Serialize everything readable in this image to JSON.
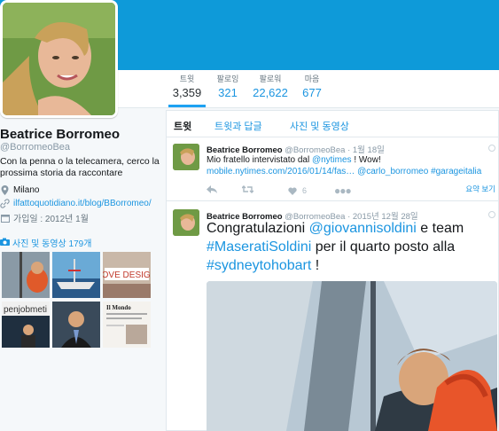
{
  "colors": {
    "banner": "#0e9ad9",
    "link": "#1b95e0",
    "accent": "#1da1f2"
  },
  "stats": [
    {
      "label": "트윗",
      "value": "3,359"
    },
    {
      "label": "팔로잉",
      "value": "321"
    },
    {
      "label": "팔로워",
      "value": "22,622"
    },
    {
      "label": "마음",
      "value": "677"
    }
  ],
  "profile": {
    "name": "Beatrice Borromeo",
    "handle": "@BorromeoBea",
    "bio": "Con la penna o la telecamera, cerco la prossima storia da raccontare",
    "location": "Milano",
    "website": "ilfattoquotidiano.it/blog/BBorromeo/",
    "joined": "가입일 : 2012년 1월",
    "photos_label": "사진 및 동영상 179개",
    "location_icon": "map-pin-icon",
    "link_icon": "link-icon",
    "calendar_icon": "calendar-icon",
    "camera_icon": "camera-icon"
  },
  "thumbs": [
    "",
    "",
    "LOVE DESIGN",
    "penjobmeti",
    "",
    "Il Mondo"
  ],
  "tabs": [
    "트윗",
    "트윗과 답글",
    "사진 및 동영상"
  ],
  "tweets": [
    {
      "name": "Beatrice Borromeo",
      "handle": "@BorromeoBea",
      "date": "· 1월 18일",
      "line1_prefix": "Mio fratello intervistato dal ",
      "line1_mention": "@nytimes",
      "line1_suffix": " ! Wow!",
      "line2_link": "mobile.nytimes.com/2016/01/14/fas…",
      "line2_mention": "@carlo_borromeo",
      "line2_hashtag": "#garageitalia",
      "like_count": "6",
      "summary_label": "요약 보기"
    },
    {
      "name": "Beatrice Borromeo",
      "handle": "@BorromeoBea",
      "date": "· 2015년 12월 28일",
      "l1_prefix": "Congratulazioni ",
      "l1_mention": "@giovannisoldini",
      "l1_suffix": " e team",
      "l2_hashtag": "#MaseratiSoldini",
      "l2_suffix": " per il quarto posto alla",
      "l3_hashtag": "#sydneytohobart",
      "l3_suffix": " !"
    }
  ]
}
